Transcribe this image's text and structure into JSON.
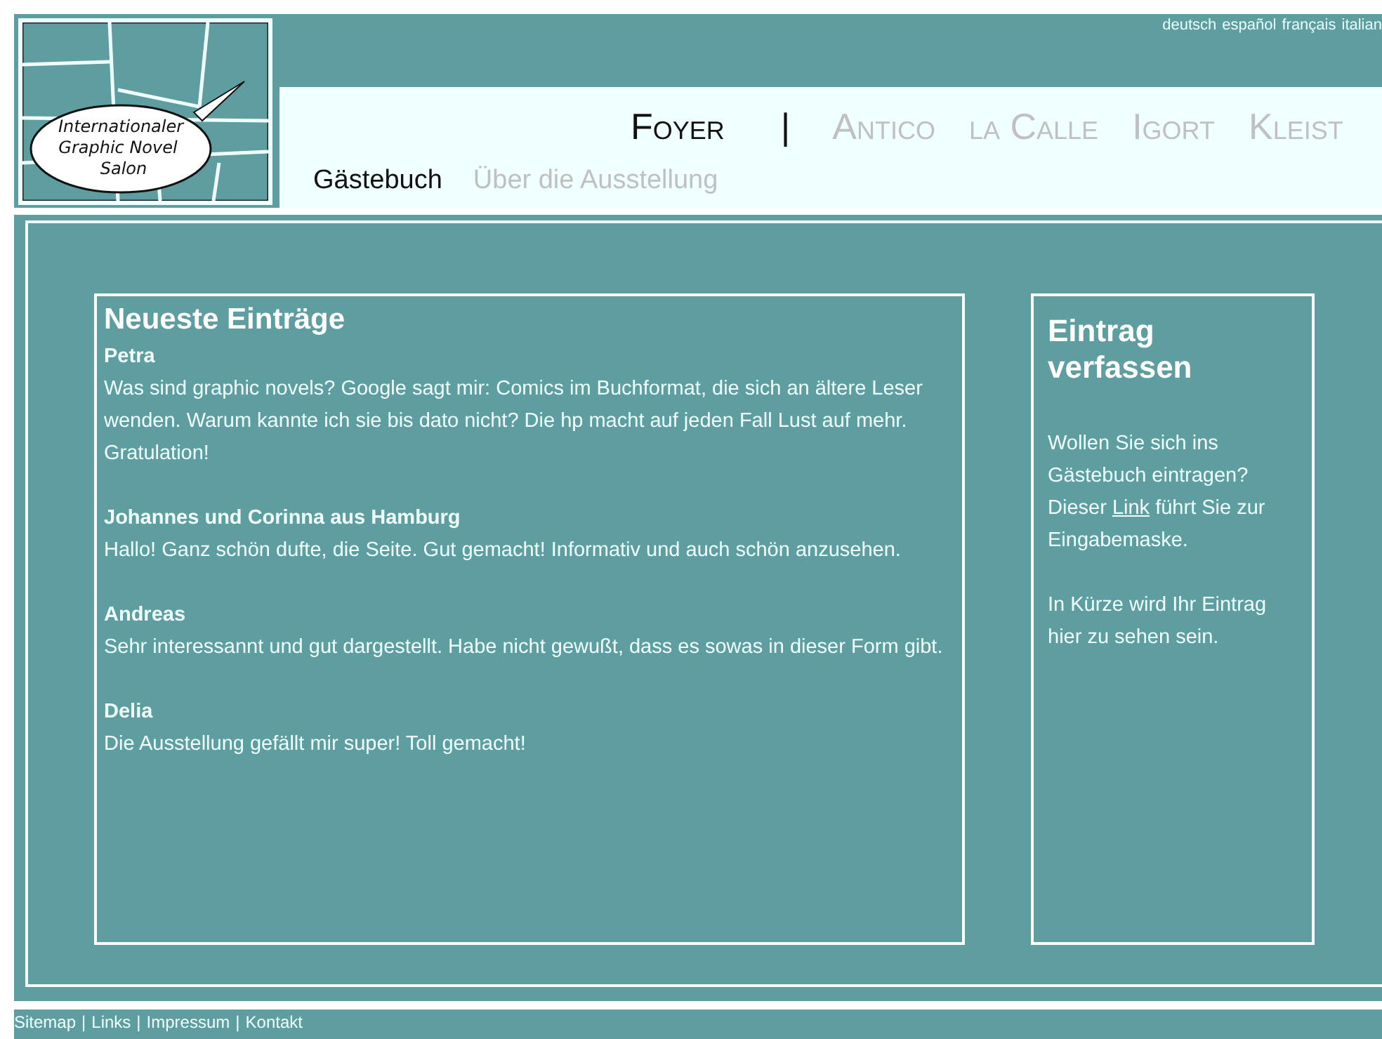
{
  "languages": [
    {
      "label": "deutsch"
    },
    {
      "label": "español"
    },
    {
      "label": "français"
    },
    {
      "label": "italian"
    }
  ],
  "logo": {
    "lines": [
      "Internationaler",
      "Graphic Novel",
      "Salon"
    ]
  },
  "nav_separator": "|",
  "main_nav": [
    {
      "label": "Foyer",
      "selected": true
    },
    {
      "label": "Antico",
      "selected": false
    },
    {
      "label": "la Calle",
      "selected": false
    },
    {
      "label": "Igort",
      "selected": false
    },
    {
      "label": "Kleist",
      "selected": false
    }
  ],
  "sub_nav": [
    {
      "label": "Gästebuch",
      "selected": true
    },
    {
      "label": "Über die Ausstellung",
      "selected": false
    }
  ],
  "entries_panel": {
    "title": "Neueste Einträge",
    "entries": [
      {
        "name": "Petra",
        "text": "Was sind graphic novels? Google sagt mir: Comics im Buchformat, die sich an ältere Leser wenden. Warum kannte ich sie bis dato nicht? Die hp macht auf jeden Fall Lust auf mehr. Gratulation!"
      },
      {
        "name": "Johannes und Corinna aus Hamburg",
        "text": "Hallo! Ganz schön dufte, die Seite. Gut gemacht! Informativ und auch schön anzusehen."
      },
      {
        "name": "Andreas",
        "text": "Sehr interessannt und gut dargestellt. Habe nicht gewußt, dass es sowas in dieser Form gibt."
      },
      {
        "name": "Delia",
        "text": "Die Ausstellung gefällt mir super! Toll gemacht!"
      }
    ]
  },
  "sidebar": {
    "title": "Eintrag verfassen",
    "paragraph_1": {
      "before": "Wollen Sie sich ins Gästebuch eintragen? Dieser",
      "link": "Link",
      "after": "führt Sie zur Eingabemaske."
    },
    "paragraph_2": "In Kürze wird Ihr Eintrag hier zu sehen sein."
  },
  "footer": [
    {
      "kind": "link",
      "label": "Sitemap"
    },
    {
      "kind": "separator",
      "label": "|"
    },
    {
      "kind": "link",
      "label": "Links"
    },
    {
      "kind": "separator",
      "label": "|"
    },
    {
      "kind": "link",
      "label": "Impressum"
    },
    {
      "kind": "separator",
      "label": "|"
    },
    {
      "kind": "link",
      "label": "Kontakt"
    }
  ]
}
